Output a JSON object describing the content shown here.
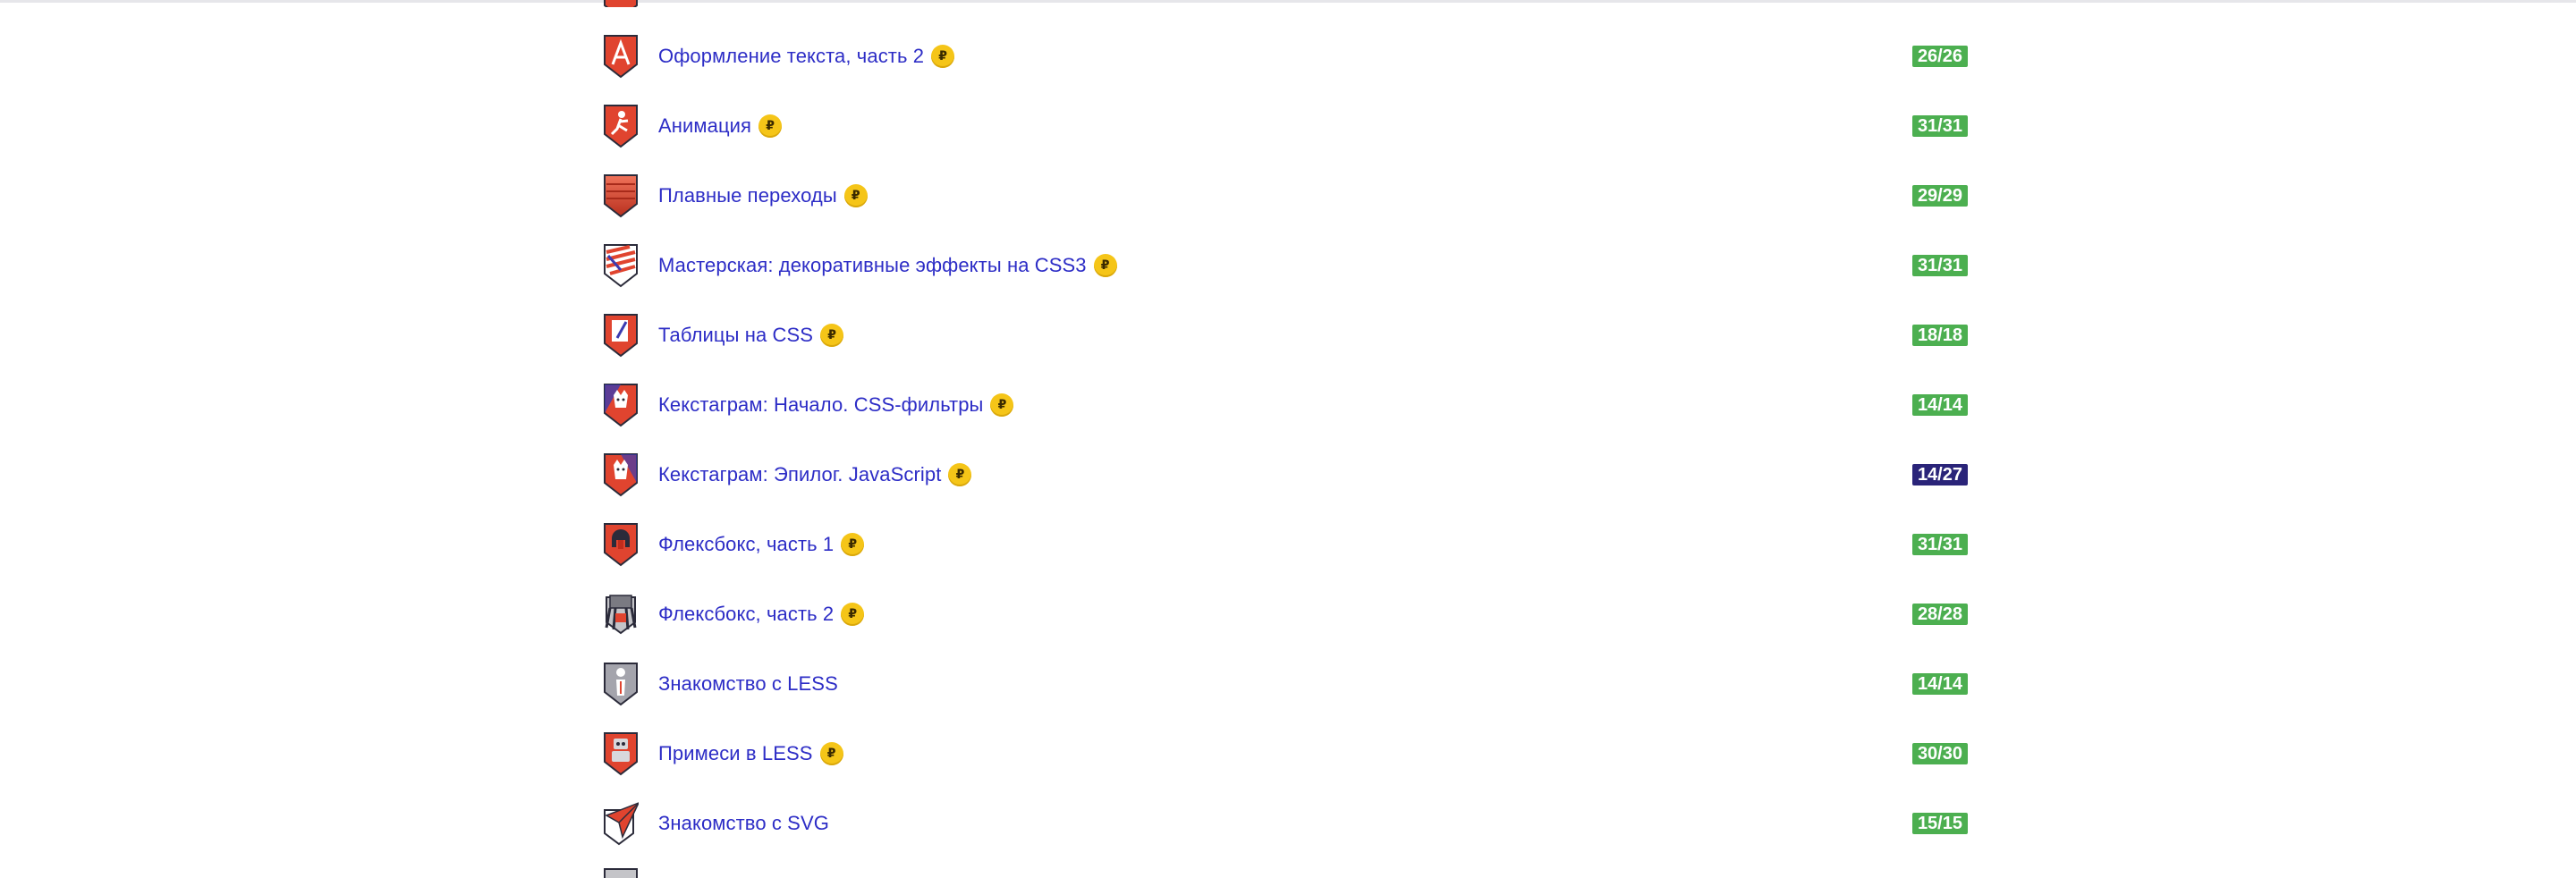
{
  "courses": [
    {
      "title": "Оформление текста, часть 2",
      "paid": true,
      "progress": "26/26",
      "status": "done",
      "badge": "letter-a-icon",
      "badge_color": "#e0442f"
    },
    {
      "title": "Анимация",
      "paid": true,
      "progress": "31/31",
      "status": "done",
      "badge": "running-figure-icon",
      "badge_color": "#e0442f"
    },
    {
      "title": "Плавные переходы",
      "paid": true,
      "progress": "29/29",
      "status": "done",
      "badge": "gradient-stripes-icon",
      "badge_color": "#e0442f"
    },
    {
      "title": "Мастерская: декоративные эффекты на CSS3",
      "paid": true,
      "progress": "31/31",
      "status": "done",
      "badge": "decorative-stripes-icon",
      "badge_color": "#e0442f"
    },
    {
      "title": "Таблицы на CSS",
      "paid": true,
      "progress": "18/18",
      "status": "done",
      "badge": "table-pen-icon",
      "badge_color": "#e0442f"
    },
    {
      "title": "Кекстаграм: Начало. CSS-фильтры",
      "paid": true,
      "progress": "14/14",
      "status": "done",
      "badge": "cat-filter-icon",
      "badge_color": "#e0442f"
    },
    {
      "title": "Кекстаграм: Эпилог. JavaScript",
      "paid": true,
      "progress": "14/27",
      "status": "in-progress",
      "badge": "cat-js-icon",
      "badge_color": "#e0442f"
    },
    {
      "title": "Флексбокс, часть 1",
      "paid": true,
      "progress": "31/31",
      "status": "done",
      "badge": "helmet-icon",
      "badge_color": "#e0442f"
    },
    {
      "title": "Флексбокс, часть 2",
      "paid": true,
      "progress": "28/28",
      "status": "done",
      "badge": "robot-walker-icon",
      "badge_color": "#8a8a8a"
    },
    {
      "title": "Знакомство с LESS",
      "paid": false,
      "progress": "14/14",
      "status": "done",
      "badge": "figure-grey-icon",
      "badge_color": "#9a9aa0"
    },
    {
      "title": "Примеси в LESS",
      "paid": true,
      "progress": "30/30",
      "status": "done",
      "badge": "robot-mixin-icon",
      "badge_color": "#e0442f"
    },
    {
      "title": "Знакомство с SVG",
      "paid": false,
      "progress": "15/15",
      "status": "done",
      "badge": "paper-plane-icon",
      "badge_color": "#e0442f"
    }
  ],
  "coin_symbol": "₽",
  "colors": {
    "link": "#2d2dc6",
    "progress_done": "#4caf50",
    "progress_active": "#2a2479",
    "coin": "#f5c518"
  }
}
